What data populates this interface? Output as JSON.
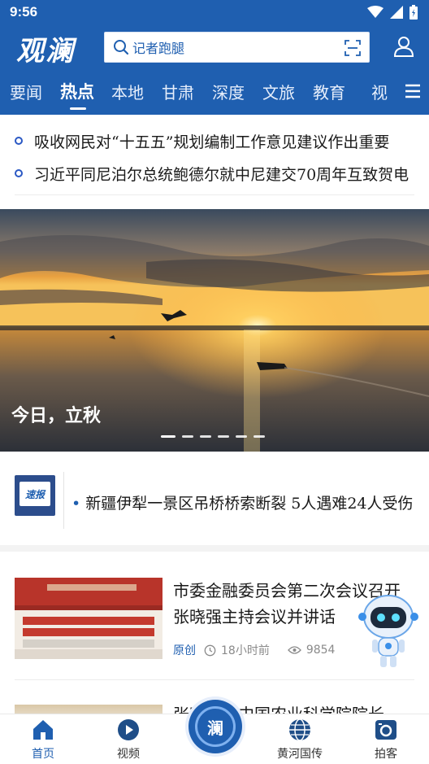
{
  "status_bar": {
    "time": "9:56"
  },
  "header": {
    "logo_text": "观澜",
    "search_placeholder": "记者跑腿"
  },
  "tabs": [
    "要闻",
    "热点",
    "本地",
    "甘肃",
    "深度",
    "文旅",
    "教育",
    "视"
  ],
  "active_tab": "热点",
  "headlines": [
    "吸收网民对“十五五”规划编制工作意见建议作出重要",
    "习近平同尼泊尔总统鲍德尔就中尼建交70周年互致贺电"
  ],
  "banner": {
    "caption": "今日，立秋",
    "slide_count": 6,
    "active_slide": 1
  },
  "flash_news": {
    "badge": "速报",
    "text": "新疆伊犁一景区吊桥桥索断裂  5人遇难24人受伤"
  },
  "news": [
    {
      "title": "市委金融委员会第二次会议召开 张晓强主持会议并讲话",
      "tag": "原创",
      "time": "18小时前",
      "views": "9854"
    },
    {
      "title": "张晓强与中国农业科学院院长"
    }
  ],
  "bottom_nav": [
    {
      "label": "首页",
      "icon": "home-icon",
      "active": true
    },
    {
      "label": "视频",
      "icon": "play-icon",
      "active": false
    },
    {
      "label": "黄河国传",
      "icon": "globe-icon",
      "active": false
    },
    {
      "label": "拍客",
      "icon": "camera-icon",
      "active": false
    }
  ],
  "center_button": "澜",
  "colors": {
    "brand": "#1f5fb0",
    "accent_text": "#1f5fb0"
  }
}
